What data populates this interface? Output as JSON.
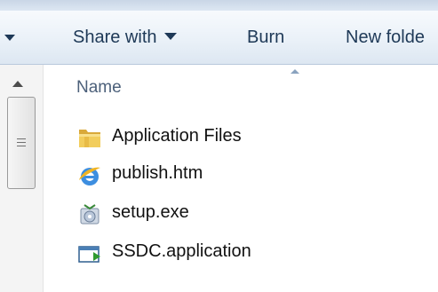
{
  "toolbar": {
    "share_with_label": "Share with",
    "burn_label": "Burn",
    "new_folder_label": "New folde"
  },
  "file_list": {
    "column_header": "Name",
    "items": [
      {
        "name": "Application Files",
        "icon": "folder-icon"
      },
      {
        "name": "publish.htm",
        "icon": "ie-html-icon"
      },
      {
        "name": "setup.exe",
        "icon": "setup-exe-icon"
      },
      {
        "name": "SSDC.application",
        "icon": "application-manifest-icon"
      }
    ]
  },
  "colors": {
    "toolbar_text": "#1e3957",
    "header_text": "#4c607a",
    "item_text": "#111111"
  }
}
